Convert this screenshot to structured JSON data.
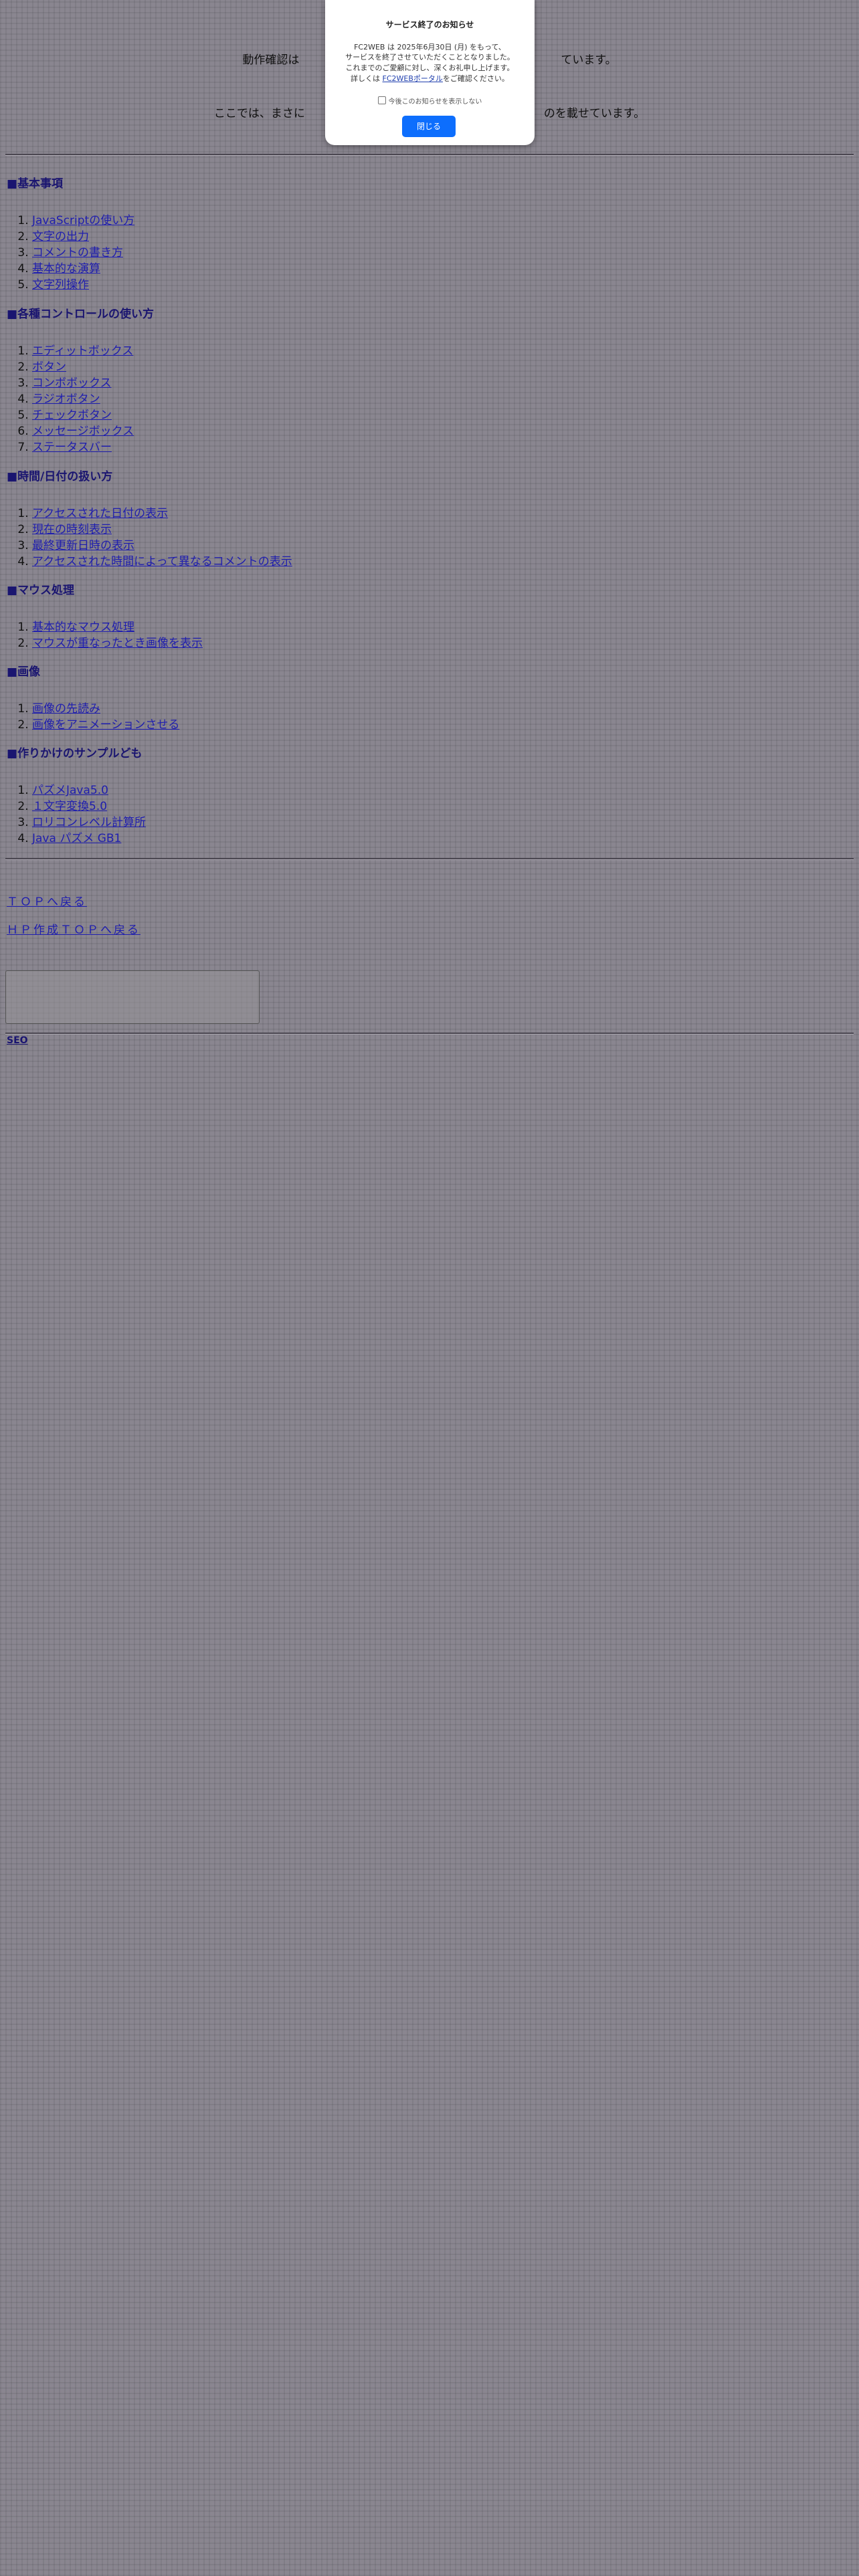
{
  "intro": {
    "line1": "動作確認は　　　　　　　　　　　　　　　　　　　　　　　ています。",
    "line2": "ここでは、まさに　　　　　　　　　　　　　　　　　　　　　のを載せています。"
  },
  "sections": [
    {
      "title": "基本事項",
      "items": [
        "JavaScriptの使い方",
        "文字の出力",
        "コメントの書き方",
        "基本的な演算",
        "文字列操作"
      ]
    },
    {
      "title": "各種コントロールの使い方",
      "items": [
        "エディットボックス",
        "ボタン",
        "コンボボックス",
        "ラジオボタン",
        "チェックボタン",
        "メッセージボックス",
        "ステータスバー"
      ]
    },
    {
      "title": "時間/日付の扱い方",
      "items": [
        "アクセスされた日付の表示",
        "現在の時刻表示",
        "最終更新日時の表示",
        "アクセスされた時間によって異なるコメントの表示"
      ]
    },
    {
      "title": "マウス処理",
      "items": [
        "基本的なマウス処理",
        "マウスが重なったとき画像を表示"
      ]
    },
    {
      "title": "画像",
      "items": [
        "画像の先読み",
        "画像をアニメーションさせる"
      ]
    },
    {
      "title": "作りかけのサンプルども",
      "items": [
        "パズメJava5.0",
        "１文字変換5.0",
        "ロリコンレベル計算所",
        "Java パズメ GB1"
      ]
    }
  ],
  "section_marker": "■",
  "nav": {
    "top_link": "ＴＯＰへ戻る",
    "hp_link": "ＨＰ作成ＴＯＰへ戻る"
  },
  "footer": {
    "seo_link": "SEO"
  },
  "modal": {
    "title": "サービス終了のお知らせ",
    "line1": "FC2WEB は 2025年6月30日 (月) をもって、",
    "line2": "サービスを終了させていただくこととなりました。",
    "line3": "これまでのご愛顧に対し、深くお礼申し上げます。",
    "line4_pre": "詳しくは ",
    "line4_link": "FC2WEBポータル",
    "line4_post": "をご確認ください。",
    "checkbox_label": "今後このお知らせを表示しない",
    "close_button": "閉じる"
  }
}
